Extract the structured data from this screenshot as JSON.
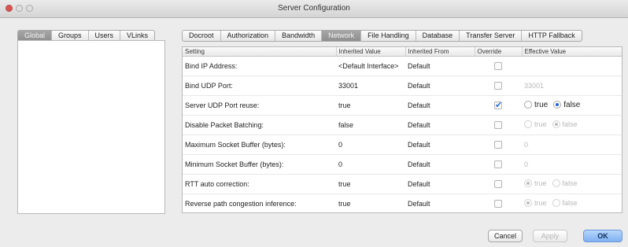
{
  "window": {
    "title": "Server Configuration"
  },
  "left_tabs": [
    "Global",
    "Groups",
    "Users",
    "VLinks"
  ],
  "left_active": 0,
  "top_tabs": [
    "Docroot",
    "Authorization",
    "Bandwidth",
    "Network",
    "File Handling",
    "Database",
    "Transfer Server",
    "HTTP Fallback"
  ],
  "top_active": 3,
  "table": {
    "headers": [
      "Setting",
      "Inherited Value",
      "Inherited From",
      "Override",
      "Effective Value"
    ],
    "rows": [
      {
        "setting": "Bind IP Address:",
        "inherited": "<Default Interface>",
        "from": "Default",
        "override": false,
        "effective": ""
      },
      {
        "setting": "Bind UDP Port:",
        "inherited": "33001",
        "from": "Default",
        "override": false,
        "effective": "33001"
      },
      {
        "setting": "Server UDP Port reuse:",
        "inherited": "true",
        "from": "Default",
        "override": true,
        "effective_true": "true",
        "effective_false": "false"
      },
      {
        "setting": "Disable Packet Batching:",
        "inherited": "false",
        "from": "Default",
        "override": false,
        "effective_true": "true",
        "effective_false": "false"
      },
      {
        "setting": "Maximum Socket Buffer (bytes):",
        "inherited": "0",
        "from": "Default",
        "override": false,
        "effective": "0"
      },
      {
        "setting": "Minimum Socket Buffer (bytes):",
        "inherited": "0",
        "from": "Default",
        "override": false,
        "effective": "0"
      },
      {
        "setting": "RTT auto correction:",
        "inherited": "true",
        "from": "Default",
        "override": false,
        "effective_true": "true",
        "effective_false": "false"
      },
      {
        "setting": "Reverse path congestion inference:",
        "inherited": "true",
        "from": "Default",
        "override": false,
        "effective_true": "true",
        "effective_false": "false"
      }
    ]
  },
  "buttons": {
    "cancel": "Cancel",
    "apply": "Apply",
    "ok": "OK"
  },
  "colors": {
    "accent": "#1d64d6",
    "default_button": "#7fb1f2",
    "active_tab": "#8e8e8e"
  }
}
